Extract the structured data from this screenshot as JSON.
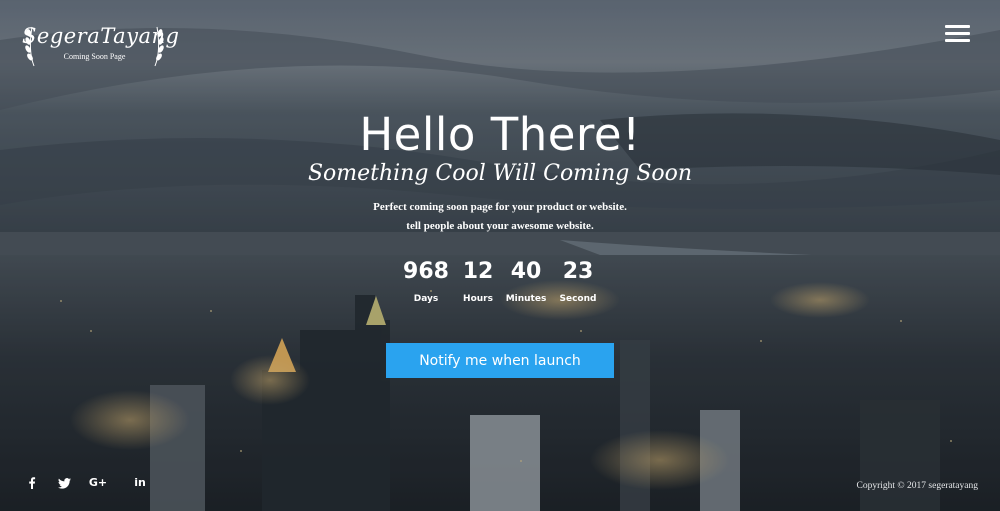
{
  "brand": {
    "name": "SegeraTayang",
    "tagline": "Coming Soon Page"
  },
  "nav": {
    "menu_icon": "hamburger-icon"
  },
  "hero": {
    "title": "Hello There!",
    "subtitle": "Something Cool Will Coming Soon",
    "description_line1": "Perfect coming soon page for your product or website.",
    "description_line2": "tell people about your awesome website."
  },
  "countdown": {
    "days": {
      "value": "968",
      "label": "Days"
    },
    "hours": {
      "value": "12",
      "label": "Hours"
    },
    "minutes": {
      "value": "40",
      "label": "Minutes"
    },
    "seconds": {
      "value": "23",
      "label": "Second"
    }
  },
  "cta": {
    "notify_label": "Notify me when launch",
    "color": "#2aa3ef"
  },
  "social": [
    {
      "icon": "facebook-icon",
      "glyph": "f"
    },
    {
      "icon": "twitter-icon",
      "glyph": "🐦"
    },
    {
      "icon": "google-plus-icon",
      "glyph": "G+"
    },
    {
      "icon": "linkedin-icon",
      "glyph": "in"
    }
  ],
  "footer": {
    "copyright": "Copyright © 2017 segeratayang"
  }
}
